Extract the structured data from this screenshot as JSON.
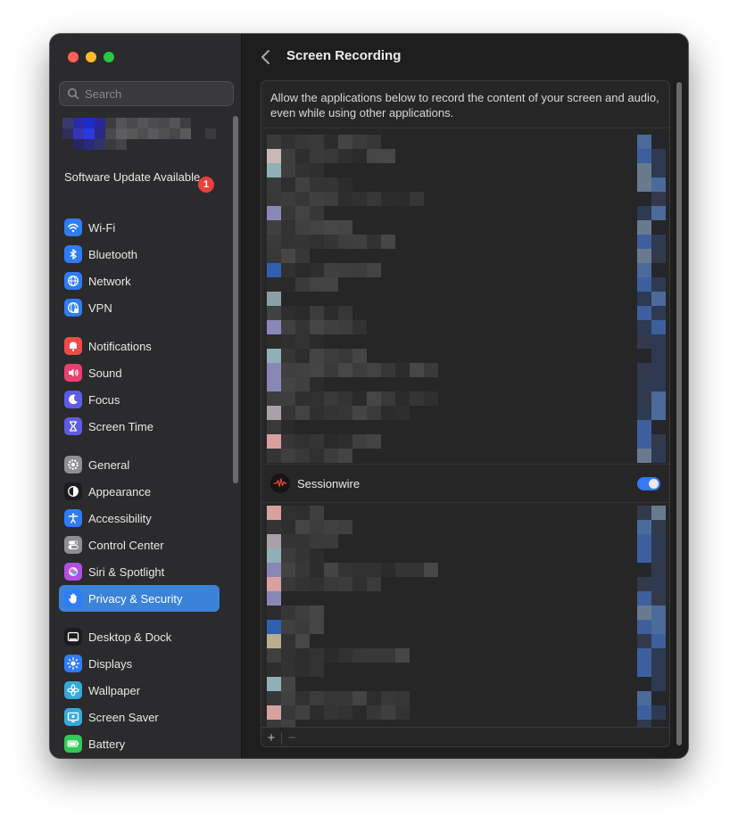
{
  "window": {
    "title": "Screen Recording"
  },
  "sidebar": {
    "search_placeholder": "Search",
    "update": {
      "label": "Software Update Available",
      "badge": "1"
    },
    "items": [
      {
        "label": "Wi-Fi",
        "icon": "wifi-icon",
        "color": "#2f7cf6"
      },
      {
        "label": "Bluetooth",
        "icon": "bluetooth-icon",
        "color": "#2f7cf6"
      },
      {
        "label": "Network",
        "icon": "globe-icon",
        "color": "#2f7cf6"
      },
      {
        "label": "VPN",
        "icon": "vpn-globe-icon",
        "color": "#2f7cf6"
      },
      {
        "label": "Notifications",
        "icon": "bell-icon",
        "color": "#ef4a4a"
      },
      {
        "label": "Sound",
        "icon": "speaker-icon",
        "color": "#ec3f6d"
      },
      {
        "label": "Focus",
        "icon": "moon-icon",
        "color": "#5e5ce6"
      },
      {
        "label": "Screen Time",
        "icon": "hourglass-icon",
        "color": "#5e5ce6"
      },
      {
        "label": "General",
        "icon": "gear-icon",
        "color": "#8e8e93"
      },
      {
        "label": "Appearance",
        "icon": "appearance-icon",
        "color": "#1c1c1e"
      },
      {
        "label": "Accessibility",
        "icon": "accessibility-icon",
        "color": "#2f7cf6"
      },
      {
        "label": "Control Center",
        "icon": "switches-icon",
        "color": "#8e8e93"
      },
      {
        "label": "Siri & Spotlight",
        "icon": "siri-icon",
        "color": "#b34fe0"
      },
      {
        "label": "Privacy & Security",
        "icon": "hand-icon",
        "color": "#2f7cf6",
        "selected": true
      },
      {
        "label": "Desktop & Dock",
        "icon": "dock-icon",
        "color": "#1c1c1e"
      },
      {
        "label": "Displays",
        "icon": "sun-icon",
        "color": "#2f7cf6"
      },
      {
        "label": "Wallpaper",
        "icon": "flower-icon",
        "color": "#35aadc"
      },
      {
        "label": "Screen Saver",
        "icon": "screensaver-icon",
        "color": "#35aadc"
      },
      {
        "label": "Battery",
        "icon": "battery-icon",
        "color": "#34c759"
      }
    ]
  },
  "main": {
    "title": "Screen Recording",
    "description": "Allow the applications below to record the content of your screen and audio, even while using other applications.",
    "visible_app": {
      "name": "Sessionwire",
      "enabled": true,
      "icon": "waveform-icon",
      "icon_color": "#e3473a"
    },
    "footer": {
      "add": "+",
      "remove": "−"
    }
  },
  "colors": {
    "accent": "#3478f6",
    "selection": "#3b82d9",
    "badge": "#e8403c"
  }
}
